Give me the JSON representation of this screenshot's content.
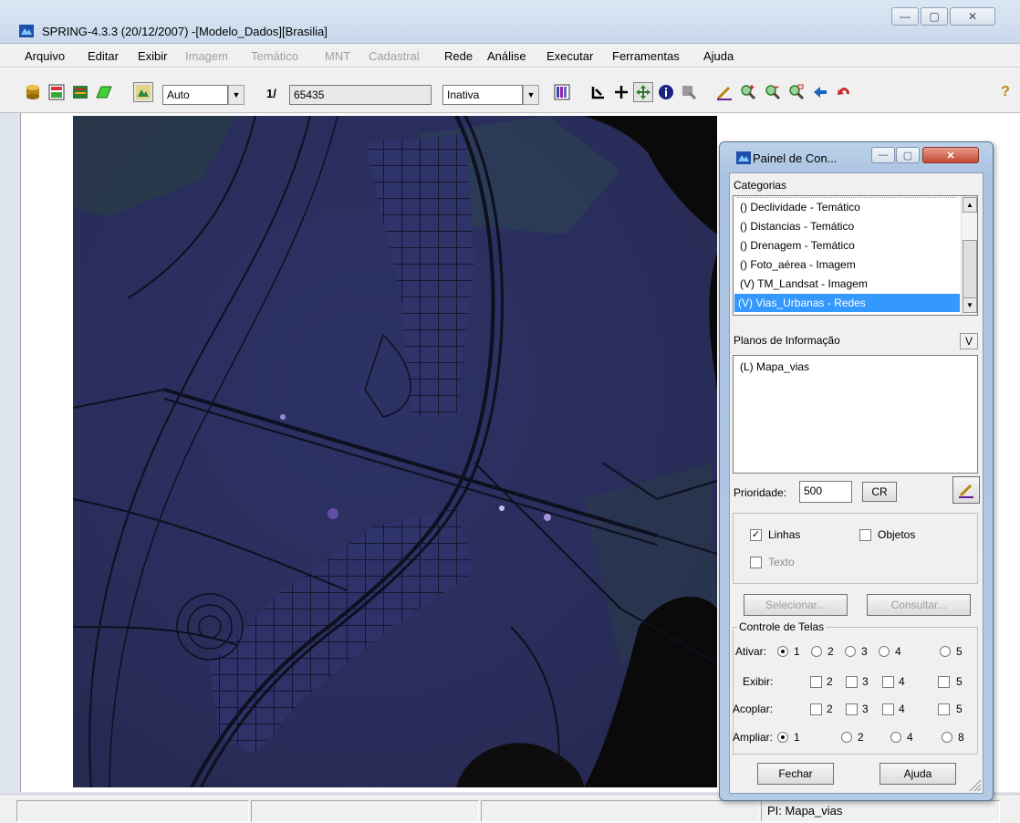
{
  "window": {
    "title": "SPRING-4.3.3 (20/12/2007) -[Modelo_Dados][Brasilia]",
    "minimize": "—",
    "maximize": "▢",
    "close": "✕"
  },
  "menu": {
    "items": [
      {
        "label": "Arquivo",
        "enabled": true
      },
      {
        "label": "Editar",
        "enabled": true
      },
      {
        "label": "Exibir",
        "enabled": true
      },
      {
        "label": "Imagem",
        "enabled": false
      },
      {
        "label": "Temático",
        "enabled": false
      },
      {
        "label": "MNT",
        "enabled": false
      },
      {
        "label": "Cadastral",
        "enabled": false
      },
      {
        "label": "Rede",
        "enabled": true
      },
      {
        "label": "Análise",
        "enabled": true
      },
      {
        "label": "Executar",
        "enabled": true
      },
      {
        "label": "Ferramentas",
        "enabled": true
      },
      {
        "label": "Ajuda",
        "enabled": true
      }
    ]
  },
  "toolbar": {
    "zoom_mode": "Auto",
    "scale_prefix": "1/",
    "scale_value": "65435",
    "edit_mode": "Inativa",
    "dropdown_arrow": "▼",
    "help_glyph": "?"
  },
  "status_bar": {
    "pi_label": "PI: Mapa_vias"
  },
  "painel": {
    "title": "Painel de Con...",
    "categorias_label": "Categorias",
    "categorias": [
      {
        "label": "() Declividade - Temático",
        "selected": false
      },
      {
        "label": "() Distancias - Temático",
        "selected": false
      },
      {
        "label": "() Drenagem - Temático",
        "selected": false
      },
      {
        "label": "() Foto_aérea - Imagem",
        "selected": false
      },
      {
        "label": "(V) TM_Landsat - Imagem",
        "selected": false
      },
      {
        "label": "(V) Vias_Urbanas - Redes",
        "selected": true
      }
    ],
    "planos_label": "Planos de Informação",
    "planos_v_button": "V",
    "planos": [
      {
        "label": "(L) Mapa_vias"
      }
    ],
    "prioridade_label": "Prioridade:",
    "prioridade_value": "500",
    "cr_button": "CR",
    "linhas_label": "Linhas",
    "linhas_checked": true,
    "objetos_label": "Objetos",
    "objetos_checked": false,
    "texto_label": "Texto",
    "texto_checked": false,
    "selecionar_button": "Selecionar...",
    "consultar_button": "Consultar...",
    "controle_label": "Controle de Telas",
    "ativar_label": "Ativar:",
    "ativar_options": [
      "1",
      "2",
      "3",
      "4",
      "5"
    ],
    "ativar_selected": "1",
    "exibir_label": "Exibir:",
    "exibir_options": [
      "2",
      "3",
      "4",
      "5"
    ],
    "acoplar_label": "Acoplar:",
    "acoplar_options": [
      "2",
      "3",
      "4",
      "5"
    ],
    "ampliar_label": "Ampliar:",
    "ampliar_options": [
      "1",
      "2",
      "4",
      "8"
    ],
    "ampliar_selected": "1",
    "fechar_button": "Fechar",
    "ajuda_button": "Ajuda",
    "check_glyph": "✓"
  },
  "colors": {
    "map_background": "#2a2f5a",
    "water": "#0b0a0a",
    "selection": "#3399ff"
  }
}
